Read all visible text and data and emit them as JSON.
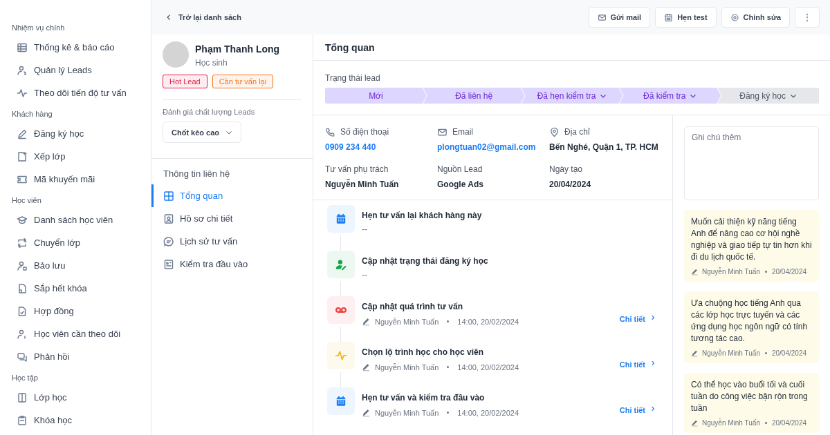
{
  "sidebar": {
    "sections": [
      {
        "title": "Nhiệm vụ chính",
        "items": [
          {
            "label": "Thống kê & báo cáo",
            "selected": false
          },
          {
            "label": "Quản lý Leads",
            "selected": false
          },
          {
            "label": "Theo dõi tiến độ tư vấn",
            "selected": false
          }
        ]
      },
      {
        "title": "Khách hàng",
        "items": [
          {
            "label": "Đăng ký học",
            "selected": false
          },
          {
            "label": "Xếp lớp",
            "selected": false
          },
          {
            "label": "Mã khuyến mãi",
            "selected": false
          }
        ]
      },
      {
        "title": "Học viên",
        "items": [
          {
            "label": "Danh sách học viên",
            "selected": false
          },
          {
            "label": "Chuyển lớp",
            "selected": false
          },
          {
            "label": "Bảo lưu",
            "selected": false
          },
          {
            "label": "Sắp hết khóa",
            "selected": false
          },
          {
            "label": "Hợp đồng",
            "selected": false
          },
          {
            "label": "Học viên cần theo dõi",
            "selected": false
          },
          {
            "label": "Phản hồi",
            "selected": false
          }
        ]
      },
      {
        "title": "Học tập",
        "items": [
          {
            "label": "Lớp học",
            "selected": false
          },
          {
            "label": "Khóa học",
            "selected": false
          }
        ]
      }
    ]
  },
  "toolbar": {
    "back": "Trở lại danh sách",
    "buttons": [
      {
        "kind": "mail",
        "label": "Gửi mail"
      },
      {
        "kind": "calendar",
        "label": "Hẹn test"
      },
      {
        "kind": "gear",
        "label": "Chỉnh sửa"
      },
      {
        "kind": "more",
        "label": "⋮"
      }
    ]
  },
  "profile": {
    "name": "Phạm Thanh Long",
    "role": "Học sinh",
    "tags": [
      {
        "label": "Hot Lead",
        "color": "#e11d48"
      },
      {
        "label": "Cần tư vấn lại",
        "color": "#f97316"
      }
    ],
    "quality_label": "Đánh giá chất lượng Leads",
    "quality_value": "Chốt kèo cao"
  },
  "nav": {
    "title": "Thông tin liên hệ",
    "items": [
      {
        "label": "Tổng quan",
        "selected": true
      },
      {
        "label": "Hồ sơ chi tiết",
        "selected": false
      },
      {
        "label": "Lịch sử tư vấn",
        "selected": false
      },
      {
        "label": "Kiểm tra đầu vào",
        "selected": false
      }
    ]
  },
  "main": {
    "title": "Tổng quan",
    "status_label": "Trạng thái lead",
    "stages": [
      {
        "label": "Mới",
        "done": true,
        "dropdown": false
      },
      {
        "label": "Đã liên hệ",
        "done": true,
        "dropdown": false
      },
      {
        "label": "Đã hẹn kiểm tra",
        "done": true,
        "dropdown": true
      },
      {
        "label": "Đã kiểm tra",
        "done": true,
        "dropdown": true
      },
      {
        "label": "Đăng ký học",
        "done": false,
        "dropdown": true
      }
    ],
    "info": [
      {
        "kind": "phone",
        "label": "Số điện thoại",
        "value": "0909 234 440",
        "link": true
      },
      {
        "kind": "mail",
        "label": "Email",
        "value": "plongtuan02@gmail.com",
        "link": true
      },
      {
        "kind": "pin",
        "label": "Địa chỉ",
        "value": "Bến Nghé, Quận 1, TP. HCM",
        "link": false
      },
      {
        "kind": "none",
        "label": "Tư vấn phụ trách",
        "value": "Nguyễn Minh Tuấn",
        "link": false
      },
      {
        "kind": "none",
        "label": "Nguồn Lead",
        "value": "Google Ads",
        "link": false
      },
      {
        "kind": "none",
        "label": "Ngày tạo",
        "value": "20/04/2024",
        "link": false
      }
    ],
    "timeline": [
      {
        "kind": "calendar",
        "color": "#1d7df2",
        "title": "Hẹn tư vấn lại khách hàng này",
        "empty": "--"
      },
      {
        "kind": "person",
        "color": "#16a34a",
        "title": "Cập nhật trạng thái đăng ký học",
        "empty": "--"
      },
      {
        "kind": "voicemail",
        "color": "#ef4444",
        "title": "Cập nhật quá trình tư vấn",
        "author": "Nguyễn Minh Tuấn",
        "time": "14:00, 20/02/2024",
        "link": "Chi tiết"
      },
      {
        "kind": "pulse",
        "color": "#eab308",
        "title": "Chọn lộ trình học cho học viên",
        "author": "Nguyễn Minh Tuấn",
        "time": "14:00, 20/02/2024",
        "link": "Chi tiết"
      },
      {
        "kind": "calendar",
        "color": "#1d7df2",
        "title": "Hẹn tư vấn và kiểm tra đầu vào",
        "author": "Nguyễn Minh Tuấn",
        "time": "14:00, 20/02/2024",
        "link": "Chi tiết"
      }
    ]
  },
  "notes": {
    "placeholder": "Ghi chú thêm",
    "items": [
      {
        "text": "Muốn cải thiện kỹ năng tiếng Anh để nâng cao cơ hội nghề nghiệp và giao tiếp tự tin hơn khi đi du lịch quốc tế.",
        "author": "Nguyễn Minh Tuấn",
        "date": "20/04/2024"
      },
      {
        "text": "Ưa chuộng học tiếng Anh qua các lớp học trực tuyến và các ứng dụng học ngôn ngữ có tính tương tác cao.",
        "author": "Nguyễn Minh Tuấn",
        "date": "20/04/2024"
      },
      {
        "text": "Có thể học vào buổi tối và cuối tuần do công việc bận rộn trong tuần",
        "author": "Nguyễn Minh Tuấn",
        "date": "20/04/2024"
      }
    ]
  }
}
